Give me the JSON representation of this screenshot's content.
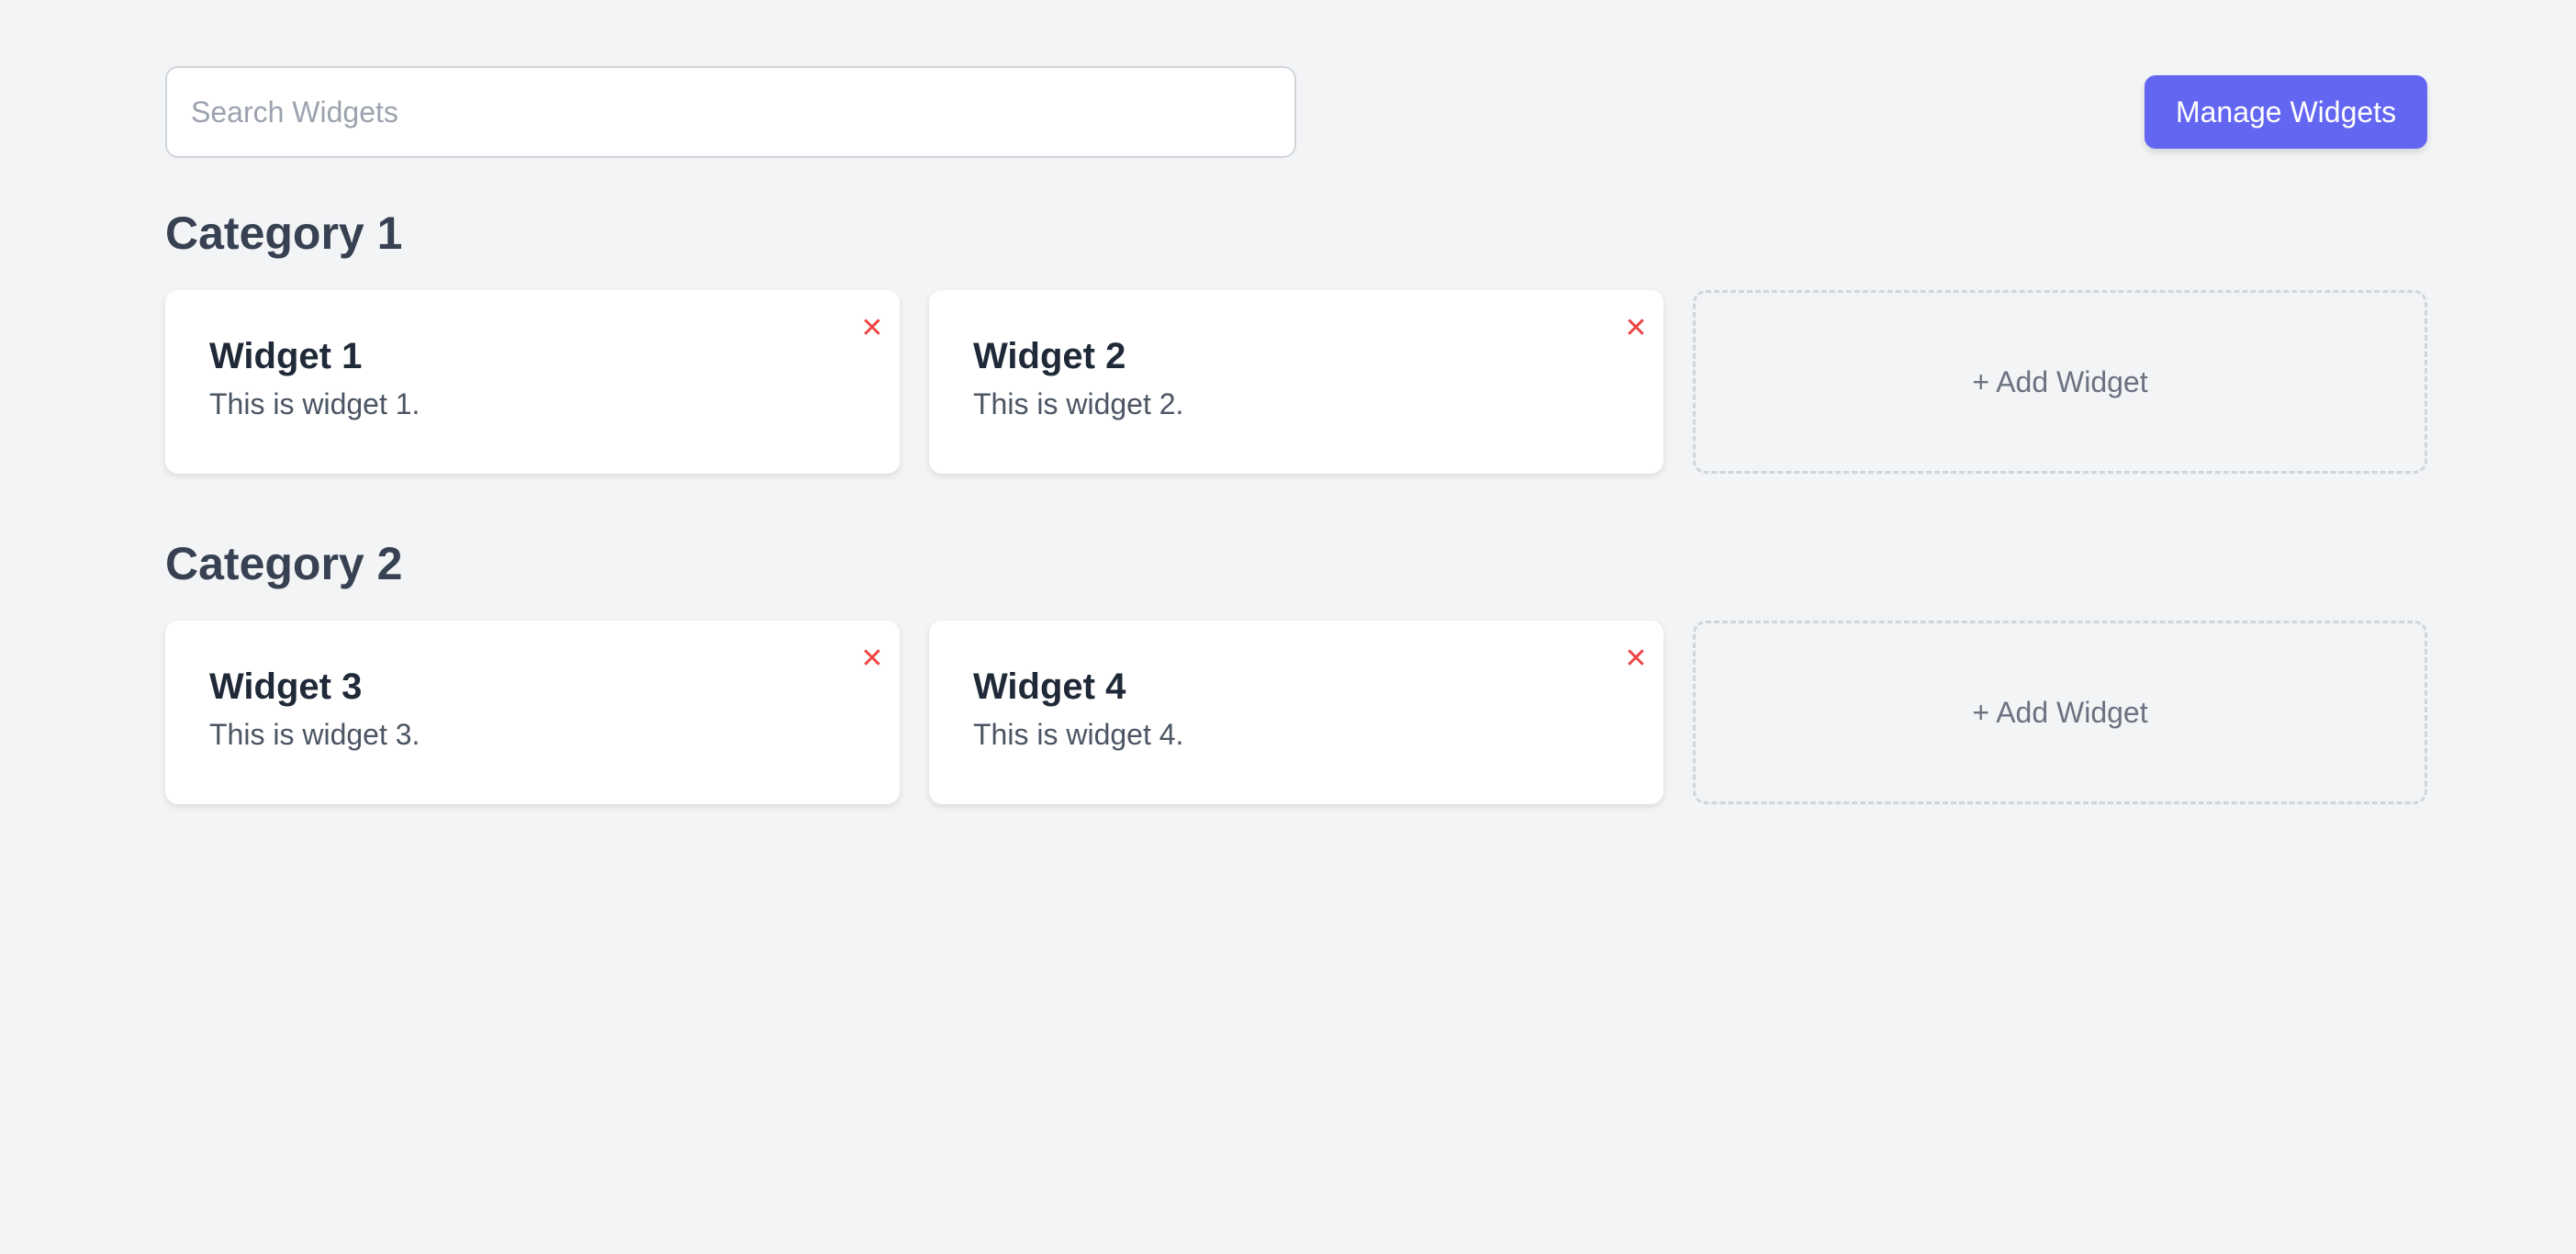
{
  "search": {
    "placeholder": "Search Widgets",
    "value": ""
  },
  "toolbar": {
    "manage_label": "Manage Widgets"
  },
  "categories": [
    {
      "title": "Category 1",
      "widgets": [
        {
          "title": "Widget 1",
          "description": "This is widget 1.",
          "remove_label": "✕"
        },
        {
          "title": "Widget 2",
          "description": "This is widget 2.",
          "remove_label": "✕"
        }
      ],
      "add_label": "+ Add Widget"
    },
    {
      "title": "Category 2",
      "widgets": [
        {
          "title": "Widget 3",
          "description": "This is widget 3.",
          "remove_label": "✕"
        },
        {
          "title": "Widget 4",
          "description": "This is widget 4.",
          "remove_label": "✕"
        }
      ],
      "add_label": "+ Add Widget"
    }
  ],
  "colors": {
    "background": "#f3f4f6",
    "accent": "#6366f1",
    "remove": "#ef4444",
    "card": "#ffffff"
  },
  "icons": {
    "remove": "close-icon"
  }
}
